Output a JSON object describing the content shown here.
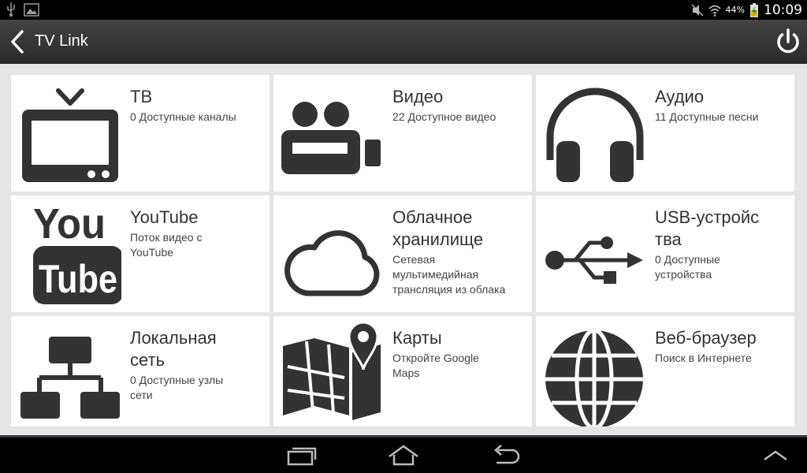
{
  "status_bar": {
    "battery_percent": "44%",
    "clock": "10:09",
    "icons": [
      "usb-icon",
      "image-icon",
      "mute-icon",
      "wifi-icon",
      "battery-icon"
    ]
  },
  "action_bar": {
    "title": "TV Link",
    "back_icon": "back-chevron-icon",
    "power_icon": "power-icon"
  },
  "tiles": [
    {
      "title": "ТВ",
      "subtitle": "0 Доступные каналы",
      "icon": "tv-icon"
    },
    {
      "title": "Видео",
      "subtitle": "22 Доступное видео",
      "icon": "video-camera-icon"
    },
    {
      "title": "Аудио",
      "subtitle": "11 Доступные песни",
      "icon": "headphones-icon"
    },
    {
      "title": "YouTube",
      "subtitle": "Поток видео с YouTube",
      "icon": "youtube-icon",
      "logo_text": [
        "You",
        "Tube"
      ]
    },
    {
      "title": "Облачное хранилище",
      "subtitle": "Сетевая мультимедийная трансляция из облака",
      "icon": "cloud-icon"
    },
    {
      "title": "USB-устройства",
      "subtitle": "0 Доступные устройства",
      "icon": "usb-icon"
    },
    {
      "title": "Локальная сеть",
      "subtitle": "0 Доступные узлы сети",
      "icon": "network-icon"
    },
    {
      "title": "Карты",
      "subtitle": "Откройте Google Maps",
      "icon": "map-icon"
    },
    {
      "title": "Веб-браузер",
      "subtitle": "Поиск в Интернете",
      "icon": "globe-icon"
    }
  ],
  "nav_bar": {
    "buttons": [
      "recent-apps-icon",
      "home-icon",
      "back-icon",
      "menu-up-icon"
    ]
  },
  "colors": {
    "icon": "#333333",
    "tile_bg": "#ffffff",
    "grid_bg": "#e5e5e5",
    "action_bar": "#333333"
  }
}
